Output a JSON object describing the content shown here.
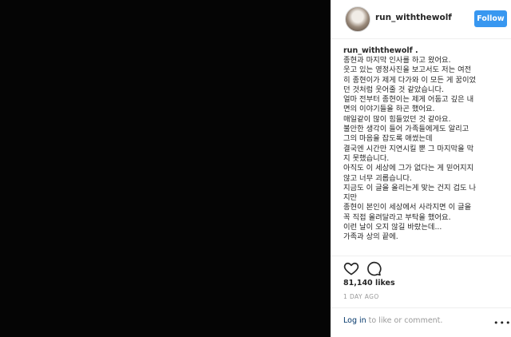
{
  "post": {
    "username": "run_withthewolf",
    "follow_label": "Follow",
    "caption_username": "run_withthewolf .",
    "caption_lines": [
      "종현과 마지막 인사를 하고 왔어요.",
      "웃고 있는 영정사진을 보고서도 저는 여전",
      "히 종현이가 제게 다가와 이 모든 게 꿈이었",
      "던 것처럼 웃어줄 것 같았습니다.",
      "얼마 전부터 종현이는 제게 어둡고 깊은 내",
      "면의 이야기들을 하곤 했어요.",
      "매일같이 많이 힘들었던 것 같아요.",
      "불안한 생각이 들어 가족들에게도 알리고",
      "그의 마음을 잡도록 애썼는데",
      "결국엔 시간만 지연시킬 뿐 그 마지막을 막",
      "지 못했습니다.",
      "아직도 이 세상에 그가 없다는 게 믿어지지",
      "않고 너무 괴롭습니다.",
      "지금도 이 글을 올리는게 맞는 건지 겁도 나",
      "지만",
      "종현이 본인이 세상에서 사라지면 이 글을",
      "꼭 직접 올려달라고 부탁을 했어요.",
      "이런 날이 오지 않길 바랐는데...",
      "가족과 상의 끝에."
    ],
    "likes": "81,140 likes",
    "date": "1 DAY AGO",
    "login_link": "Log in",
    "login_suffix": " to like or comment.",
    "more_label": "•••"
  },
  "icons": {
    "like": "heart-icon",
    "comment": "comment-icon",
    "more": "more-options-icon"
  },
  "colors": {
    "accent": "#3897f0",
    "media_background": "#050505",
    "muted": "#999999",
    "link": "#003569"
  }
}
